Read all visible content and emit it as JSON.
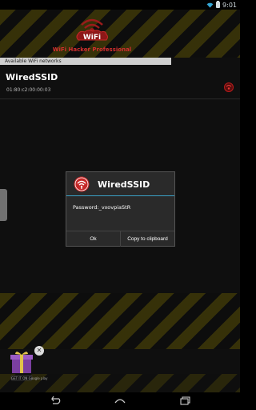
{
  "status_bar": {
    "time": "9:01"
  },
  "header": {
    "logo_text": "WiFi",
    "app_title": "WiFi Hacker Professional"
  },
  "section": {
    "label": "Available WiFi networks"
  },
  "network": {
    "ssid": "WiredSSID",
    "mac": "01:80:c2:00:00:03"
  },
  "dialog": {
    "title": "WiredSSID",
    "password_label": "Password:",
    "password_value": "_vxovpiaStR",
    "ok_label": "Ok",
    "copy_label": "Copy to clipboard"
  },
  "ad": {
    "badge": "GET IT ON Google play"
  },
  "colors": {
    "accent_red": "#d32f2f",
    "accent_blue": "#3aa0c6",
    "stripe_yellow": "#3a3508"
  },
  "icons": [
    "wifi-icon",
    "battery-icon",
    "logo-icon",
    "network-lock-icon",
    "dialog-wifi-icon",
    "gift-icon",
    "close-icon",
    "back-icon",
    "home-icon",
    "recents-icon"
  ]
}
